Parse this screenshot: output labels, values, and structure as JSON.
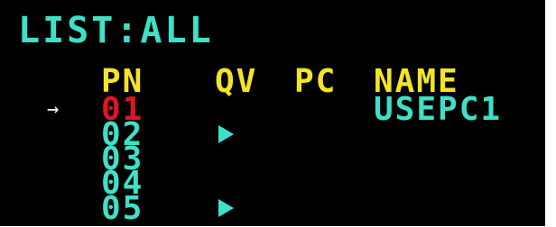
{
  "screen": {
    "title": "LIST:ALL",
    "colors": {
      "text": "#3ee0c8",
      "header": "#f4e426",
      "selected": "#e01424",
      "background": "#000000"
    }
  },
  "table": {
    "headers": {
      "pn": "PN",
      "qv": "QV",
      "pc": "PC",
      "name": "NAME"
    },
    "rows": [
      {
        "pn": "01",
        "selected": true,
        "cursor": "→",
        "qv": false,
        "name": "USEPC1"
      },
      {
        "pn": "02",
        "selected": false,
        "qv": true,
        "qv_icon": "play-triangle-icon",
        "name": ""
      },
      {
        "pn": "03",
        "selected": false,
        "qv": false,
        "name": ""
      },
      {
        "pn": "04",
        "selected": false,
        "qv": false,
        "name": ""
      },
      {
        "pn": "05",
        "selected": false,
        "qv": true,
        "qv_icon": "play-triangle-icon",
        "name": ""
      }
    ]
  }
}
